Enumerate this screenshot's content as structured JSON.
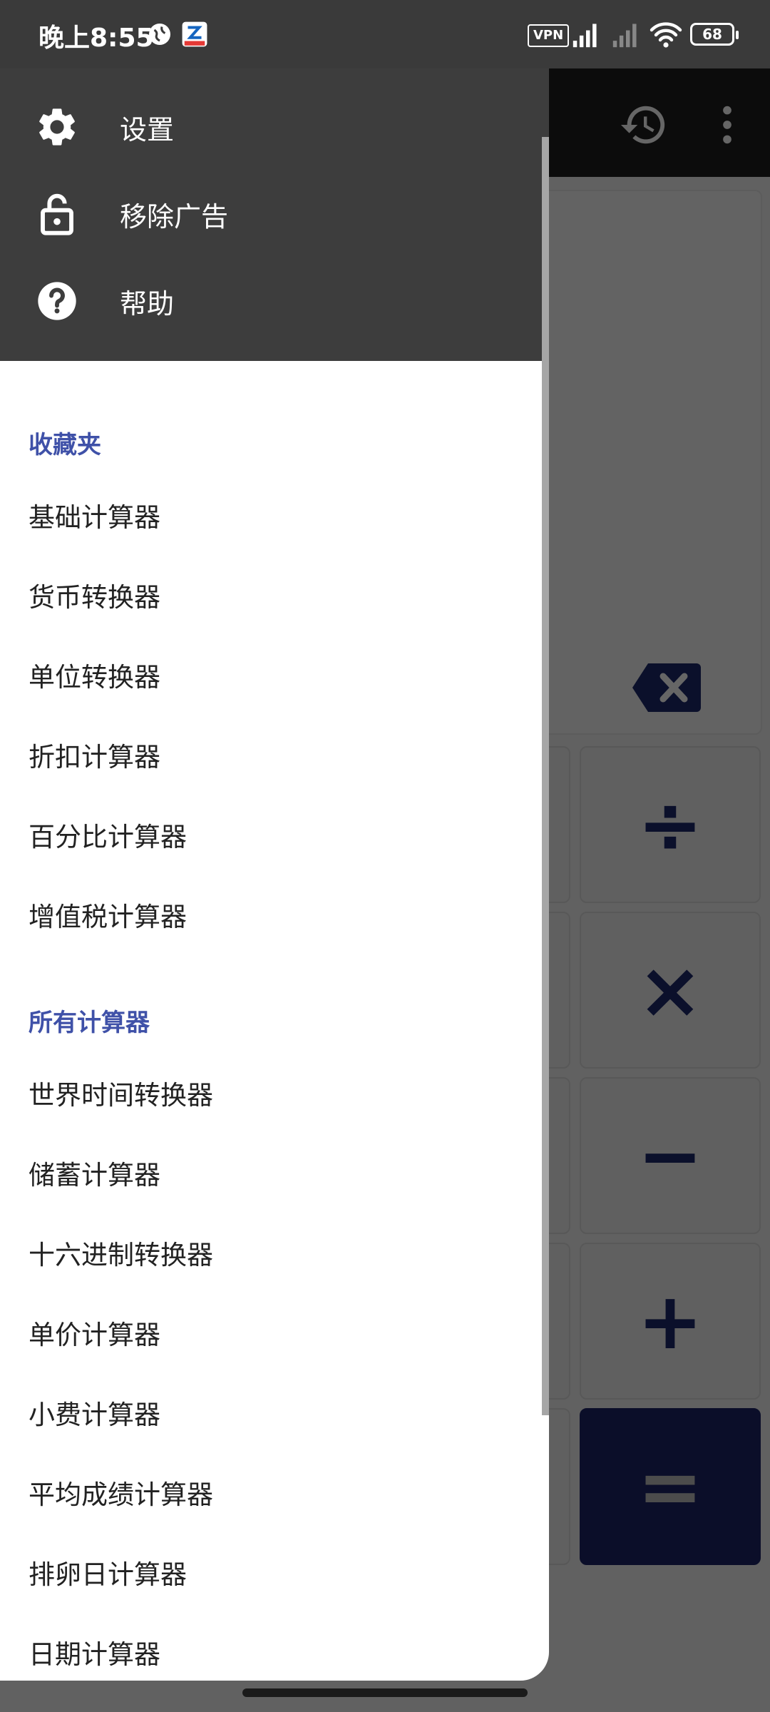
{
  "status_bar": {
    "time": "晚上8:55",
    "vpn": "VPN",
    "battery": "68"
  },
  "drawer": {
    "header_items": [
      {
        "label": "设置",
        "icon": "gear-icon"
      },
      {
        "label": "移除广告",
        "icon": "unlock-icon"
      },
      {
        "label": "帮助",
        "icon": "help-icon"
      }
    ],
    "favorites_title": "收藏夹",
    "favorites": [
      "基础计算器",
      "货币转换器",
      "单位转换器",
      "折扣计算器",
      "百分比计算器",
      "增值税计算器"
    ],
    "all_title": "所有计算器",
    "all": [
      "世界时间转换器",
      "储蓄计算器",
      "十六进制转换器",
      "单价计算器",
      "小费计算器",
      "平均成绩计算器",
      "排卵日计算器",
      "日期计算器"
    ]
  },
  "calculator": {
    "keys": [
      "÷",
      "×",
      "−",
      "+",
      "="
    ],
    "accent_color": "#1c2466"
  }
}
